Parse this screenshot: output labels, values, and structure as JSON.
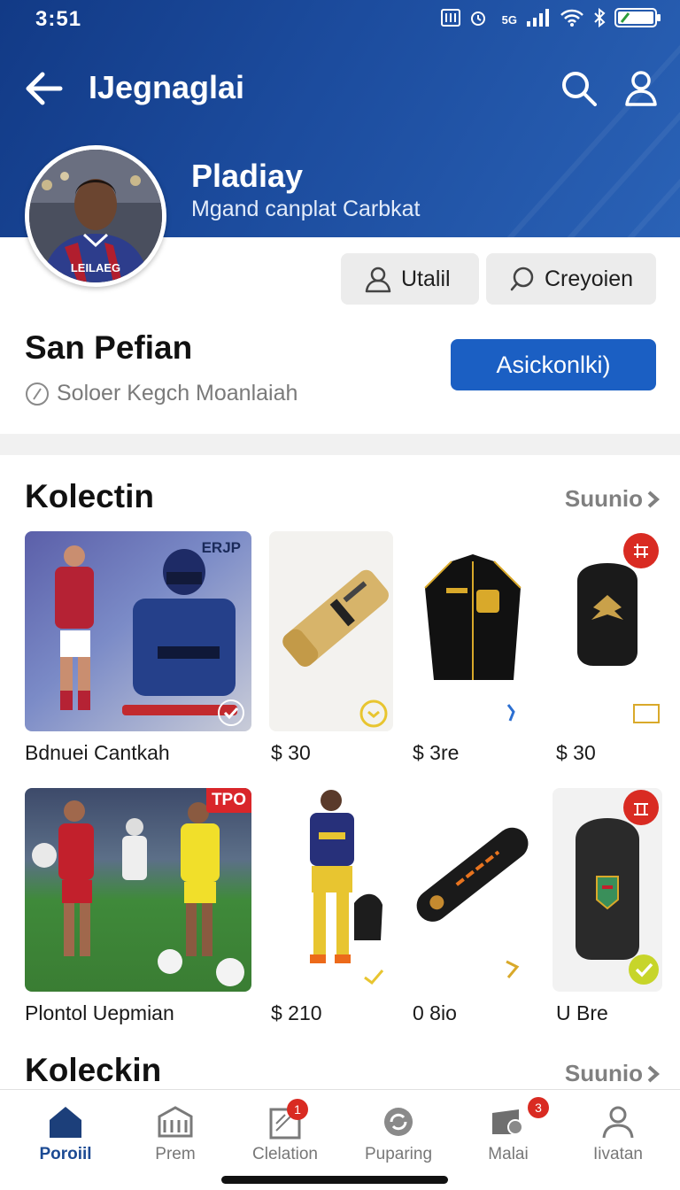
{
  "status": {
    "time": "3:51",
    "signal": "5G"
  },
  "header": {
    "title": "IJegnaglai"
  },
  "profile": {
    "display_name": "Pladiay",
    "subtitle": "Mgand canplat Carbkat",
    "avatar_jersey_text": "LEILAEG",
    "pill1_label": "Utalil",
    "pill2_label": "Creyoien",
    "user_name": "San Pefian",
    "location": "Soloer Kegch Moanlaiah",
    "primary_label": "Asickonlki)"
  },
  "section1": {
    "title": "Kolectin",
    "see_all": "Suunio",
    "items": [
      {
        "caption": "Bdnuei Cantkah",
        "tag": "ERJP"
      },
      {
        "caption": "$ 30"
      },
      {
        "caption": "$ 3re"
      },
      {
        "caption": "$ 30"
      }
    ]
  },
  "section2": {
    "items": [
      {
        "caption": "Plontol Uepmian",
        "tag": "TPO"
      },
      {
        "caption": "$ 210"
      },
      {
        "caption": "0 8io"
      },
      {
        "caption": "U Bre"
      }
    ]
  },
  "section3": {
    "title": "Koleckin",
    "see_all": "Suunio"
  },
  "nav": {
    "items": [
      {
        "label": "Poroiil"
      },
      {
        "label": "Prem"
      },
      {
        "label": "Clelation",
        "badge": "1"
      },
      {
        "label": "Puparing"
      },
      {
        "label": "Malai",
        "badge": "3"
      },
      {
        "label": "Iivatan"
      }
    ]
  },
  "colors": {
    "brand": "#1c4a93",
    "accent": "#1b5fc3",
    "badge": "#d92b22"
  }
}
